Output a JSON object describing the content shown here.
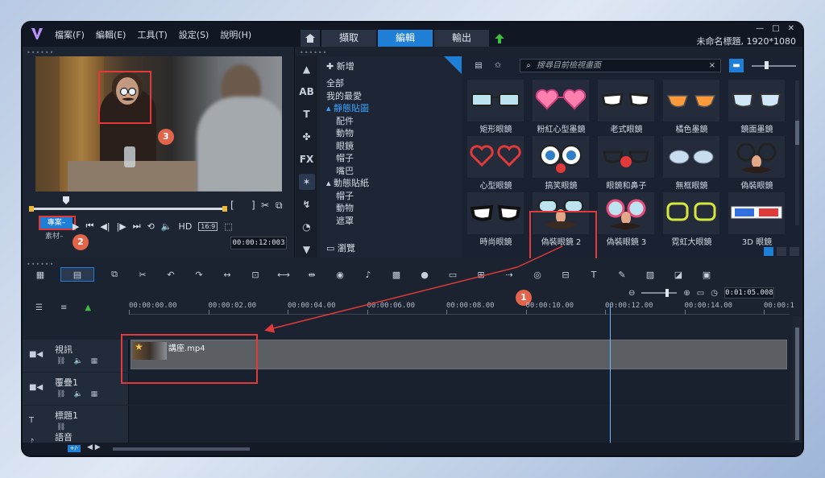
{
  "menu": [
    "檔案(F)",
    "編輯(E)",
    "工具(T)",
    "設定(S)",
    "說明(H)"
  ],
  "tabs": {
    "capture": "擷取",
    "edit": "編輯",
    "share": "輸出"
  },
  "window": {
    "controls": [
      "—",
      "□",
      "✕"
    ],
    "title": "未命名標題, 1920*1080"
  },
  "preview": {
    "project_tag": "專案–",
    "material_tag": "素材–",
    "hd_label": "HD",
    "aspect_label": "16:9",
    "timecode": "00:00:12:003"
  },
  "library": {
    "add_label": "新增",
    "tree": [
      "全部",
      "我的最愛",
      "靜態貼圖",
      "配件",
      "動物",
      "眼鏡",
      "帽子",
      "嘴巴",
      "動態貼紙",
      "帽子",
      "動物",
      "遮罩"
    ],
    "selected_tree_index": 2,
    "browse_label": "瀏覽",
    "search_placeholder": "搜尋目前檢視畫面",
    "stickers": [
      {
        "label": "矩形眼鏡",
        "icon": "rect-glasses"
      },
      {
        "label": "粉紅心型墨鏡",
        "icon": "pink-heart-glasses"
      },
      {
        "label": "老式眼鏡",
        "icon": "old-glasses"
      },
      {
        "label": "橘色墨鏡",
        "icon": "orange-sunglasses"
      },
      {
        "label": "鏡面墨鏡",
        "icon": "mirror-sunglasses"
      },
      {
        "label": "心型眼鏡",
        "icon": "heart-glasses"
      },
      {
        "label": "搞笑眼鏡",
        "icon": "funny-glasses"
      },
      {
        "label": "眼鏡和鼻子",
        "icon": "glasses-nose"
      },
      {
        "label": "無框眼鏡",
        "icon": "rimless-glasses"
      },
      {
        "label": "偽裝眼鏡",
        "icon": "disguise-glasses"
      },
      {
        "label": "時尚眼鏡",
        "icon": "fashion-glasses"
      },
      {
        "label": "偽裝眼鏡 2",
        "icon": "disguise-glasses-2"
      },
      {
        "label": "偽裝眼鏡 3",
        "icon": "disguise-glasses-3"
      },
      {
        "label": "霓虹大眼鏡",
        "icon": "neon-glasses"
      },
      {
        "label": "3D 眼鏡",
        "icon": "3d-glasses"
      }
    ]
  },
  "timeline": {
    "time_display": "0:01:05.008",
    "ruler": [
      "00:00:00.00",
      "00:00:02.00",
      "00:00:04.00",
      "00:00:06.00",
      "00:00:08.00",
      "00:00:10.00",
      "00:00:12.00",
      "00:00:14.00",
      "00:00:1"
    ],
    "tracks": [
      {
        "name": "視訊",
        "icon": "video-track-icon"
      },
      {
        "name": "覆疊1",
        "icon": "overlay-track-icon"
      },
      {
        "name": "標題1",
        "icon": "title-track-icon"
      },
      {
        "name": "語音",
        "icon": "voice-track-icon"
      }
    ],
    "clip_name": "講座.mp4",
    "bottom_tag": "+/-"
  },
  "callouts": [
    "1",
    "2",
    "3"
  ],
  "colors": {
    "accent": "#1f7fd6",
    "highlight": "#e03a3a",
    "badge": "#e2654b"
  }
}
